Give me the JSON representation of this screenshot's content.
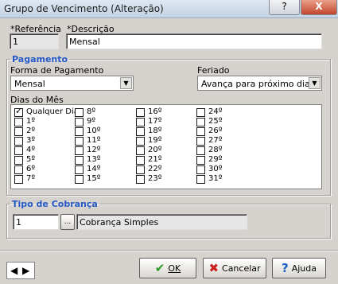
{
  "window": {
    "title": "Grupo de Vencimento (Alteração)",
    "help_glyph": "?",
    "close_glyph": "X"
  },
  "referencia": {
    "label": "*Referência",
    "value": "1"
  },
  "descricao": {
    "label": "*Descrição",
    "value": "Mensal"
  },
  "pagamento": {
    "legend": "Pagamento",
    "forma_label": "Forma de Pagamento",
    "forma_value": "Mensal",
    "feriado_label": "Feriado",
    "feriado_value": "Avança para próximo dia",
    "dias_label": "Dias do Mês",
    "days": [
      {
        "label": "Qualquer Dia",
        "checked": true
      },
      {
        "label": "1º",
        "checked": false
      },
      {
        "label": "2º",
        "checked": false
      },
      {
        "label": "3º",
        "checked": false
      },
      {
        "label": "4º",
        "checked": false
      },
      {
        "label": "5º",
        "checked": false
      },
      {
        "label": "6º",
        "checked": false
      },
      {
        "label": "7º",
        "checked": false
      },
      {
        "label": "8º",
        "checked": false
      },
      {
        "label": "9º",
        "checked": false
      },
      {
        "label": "10º",
        "checked": false
      },
      {
        "label": "11º",
        "checked": false
      },
      {
        "label": "12º",
        "checked": false
      },
      {
        "label": "13º",
        "checked": false
      },
      {
        "label": "14º",
        "checked": false
      },
      {
        "label": "15º",
        "checked": false
      },
      {
        "label": "16º",
        "checked": false
      },
      {
        "label": "17º",
        "checked": false
      },
      {
        "label": "18º",
        "checked": false
      },
      {
        "label": "19º",
        "checked": false
      },
      {
        "label": "20º",
        "checked": false
      },
      {
        "label": "21º",
        "checked": false
      },
      {
        "label": "22º",
        "checked": false
      },
      {
        "label": "23º",
        "checked": false
      },
      {
        "label": "24º",
        "checked": false
      },
      {
        "label": "25º",
        "checked": false
      },
      {
        "label": "26º",
        "checked": false
      },
      {
        "label": "27º",
        "checked": false
      },
      {
        "label": "28º",
        "checked": false
      },
      {
        "label": "29º",
        "checked": false
      },
      {
        "label": "30º",
        "checked": false
      },
      {
        "label": "31º",
        "checked": false
      }
    ]
  },
  "cobranca": {
    "legend": "Tipo de Cobrança",
    "code": "1",
    "lookup_label": "...",
    "name": "Cobrança Simples"
  },
  "footer": {
    "ok_label": "OK",
    "cancel_label": "Cancelar",
    "help_label": "Ajuda"
  }
}
